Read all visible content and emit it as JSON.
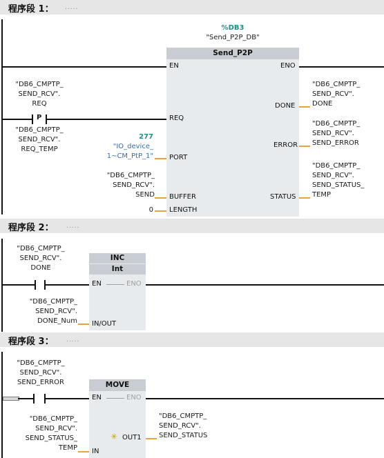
{
  "segments": [
    {
      "title": "程序段 1：",
      "comment": "....."
    },
    {
      "title": "程序段 2：",
      "comment": "....."
    },
    {
      "title": "程序段 3：",
      "comment": "....."
    }
  ],
  "net1": {
    "db_number": "%DB3",
    "db_name": "\"Send_P2P_DB\"",
    "block_title": "Send_P2P",
    "pins": {
      "en": "EN",
      "eno": "ENO",
      "req": "REQ",
      "port": "PORT",
      "buffer": "BUFFER",
      "length": "LENGTH",
      "done": "DONE",
      "error": "ERROR",
      "status": "STATUS"
    },
    "req_operand": [
      "\"DB6_CMPTP_",
      "SEND_RCV\".",
      "REQ"
    ],
    "p_contact_label": "P",
    "req_temp_operand": [
      "\"DB6_CMPTP_",
      "SEND_RCV\".",
      "REQ_TEMP"
    ],
    "port_value": "277",
    "port_operand": [
      "\"IO_device_",
      "1~CM_PtP_1\""
    ],
    "buffer_operand": [
      "\"DB6_CMPTP_",
      "SEND_RCV\".",
      "SEND"
    ],
    "length_value": "0",
    "done_operand": [
      "\"DB6_CMPTP_",
      "SEND_RCV\".",
      "DONE"
    ],
    "error_operand": [
      "\"DB6_CMPTP_",
      "SEND_RCV\".",
      "SEND_ERROR"
    ],
    "status_operand": [
      "\"DB6_CMPTP_",
      "SEND_RCV\".",
      "SEND_STATUS_",
      "TEMP"
    ]
  },
  "net2": {
    "block_title": "INC",
    "block_type": "Int",
    "pins": {
      "en": "EN",
      "eno": "ENO",
      "inout": "IN/OUT"
    },
    "contact_operand": [
      "\"DB6_CMPTP_",
      "SEND_RCV\".",
      "DONE"
    ],
    "inout_operand": [
      "\"DB6_CMPTP_",
      "SEND_RCV\".",
      "DONE_Num"
    ]
  },
  "net3": {
    "block_title": "MOVE",
    "pins": {
      "en": "EN",
      "eno": "ENO",
      "in": "IN",
      "out1": "OUT1"
    },
    "contact_operand": [
      "\"DB6_CMPTP_",
      "SEND_RCV\".",
      "SEND_ERROR"
    ],
    "in_operand": [
      "\"DB6_CMPTP_",
      "SEND_RCV\".",
      "SEND_STATUS_",
      "TEMP"
    ],
    "out1_operand": [
      "\"DB6_CMPTP_",
      "SEND_RCV\".",
      "SEND_STATUS"
    ]
  },
  "colors": {
    "header_bg": "#e6e6e6",
    "block_bg": "#e8ebee",
    "block_title_bg": "#c7cdd3",
    "pin_stub": "#e8a33a",
    "db_number": "#1c8c8c",
    "port_operand": "#2f6fb8"
  }
}
